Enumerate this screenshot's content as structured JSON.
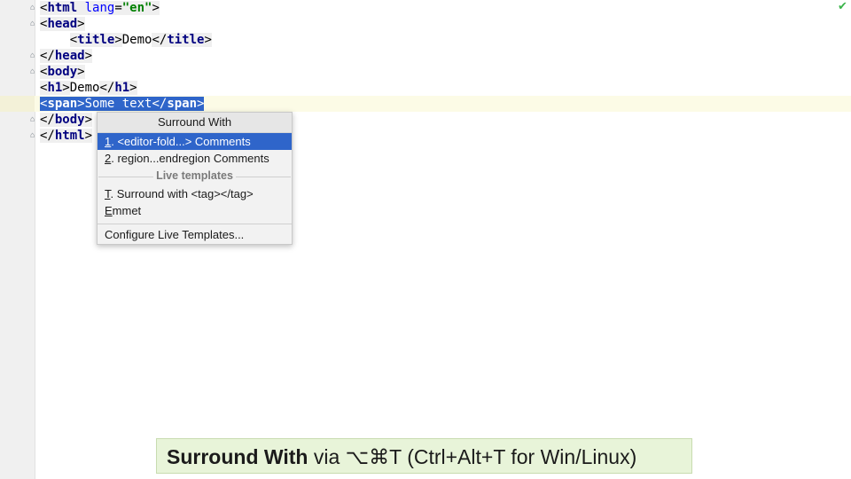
{
  "editor": {
    "lines": [
      {
        "p1": "<",
        "tag": "html",
        "sp": " ",
        "attr": "lang",
        "eq": "=",
        "val": "\"en\"",
        "p2": ">"
      },
      {
        "p1": "<",
        "tag": "head",
        "p2": ">"
      },
      {
        "indent": "    ",
        "p1": "<",
        "tag": "title",
        "p2": ">",
        "text": "Demo",
        "p3": "</",
        "tag2": "title",
        "p4": ">"
      },
      {
        "p1": "</",
        "tag": "head",
        "p2": ">"
      },
      {
        "p1": "<",
        "tag": "body",
        "p2": ">"
      },
      {
        "p1": "<",
        "tag": "h1",
        "p2": ">",
        "text": "Demo",
        "p3": "</",
        "tag2": "h1",
        "p4": ">"
      },
      {
        "p1": "<",
        "tag": "span",
        "p2": ">",
        "text": "Some text",
        "p3": "</",
        "tag2": "span",
        "p4": ">"
      },
      {
        "p1": "</",
        "tag": "body",
        "p2": ">"
      },
      {
        "p1": "</",
        "tag": "html",
        "p2": ">"
      }
    ],
    "status_icon": "checkmark-icon",
    "colors": {
      "selection": "#2f65ca",
      "tag": "#000080",
      "attr": "#0000ff",
      "string": "#008000"
    }
  },
  "popup": {
    "title": "Surround With",
    "items": [
      {
        "mnemonic": "1",
        "rest": ". <editor-fold...> Comments"
      },
      {
        "mnemonic": "2",
        "rest": ". region...endregion Comments"
      }
    ],
    "section_label": "Live templates",
    "templates": [
      {
        "mnemonic": "T",
        "rest": ". Surround with <tag></tag>"
      },
      {
        "mnemonic": "E",
        "rest": "mmet"
      }
    ],
    "configure_label": "Configure Live Templates..."
  },
  "tip": {
    "bold": "Surround With",
    "rest": " via ⌥⌘T (Ctrl+Alt+T for Win/Linux)",
    "background": "#e8f4d9"
  }
}
